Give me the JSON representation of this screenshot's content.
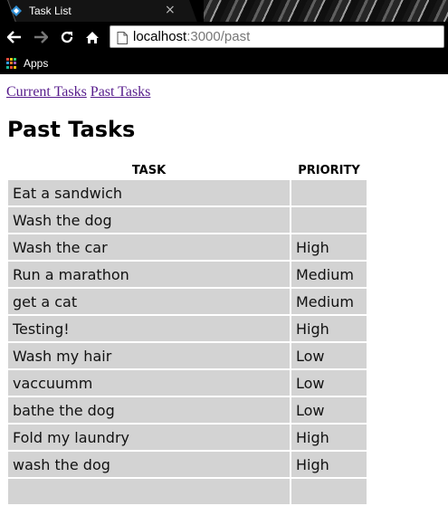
{
  "browser": {
    "tab_title": "Task List",
    "tab_close": "×",
    "url_host": "localhost",
    "url_rest": ":3000/past",
    "bookmarks": {
      "apps_label": "Apps"
    },
    "colors": {
      "chrome_bg": "#000000",
      "favicon": "#2f8fd6"
    }
  },
  "nav": {
    "current_label": "Current Tasks",
    "past_label": "Past Tasks"
  },
  "page_title": "Past Tasks",
  "table": {
    "headers": [
      "TASK",
      "PRIORITY"
    ],
    "rows": [
      {
        "task": "Eat a sandwich",
        "priority": ""
      },
      {
        "task": "Wash the dog",
        "priority": ""
      },
      {
        "task": "Wash the car",
        "priority": "High"
      },
      {
        "task": "Run a marathon",
        "priority": "Medium"
      },
      {
        "task": "get a cat",
        "priority": "Medium"
      },
      {
        "task": "Testing!",
        "priority": "High"
      },
      {
        "task": "Wash my hair",
        "priority": "Low"
      },
      {
        "task": "vaccuumm",
        "priority": "Low"
      },
      {
        "task": "bathe the dog",
        "priority": "Low"
      },
      {
        "task": "Fold my laundry",
        "priority": "High"
      },
      {
        "task": "wash the dog",
        "priority": "High"
      },
      {
        "task": "",
        "priority": ""
      }
    ]
  }
}
